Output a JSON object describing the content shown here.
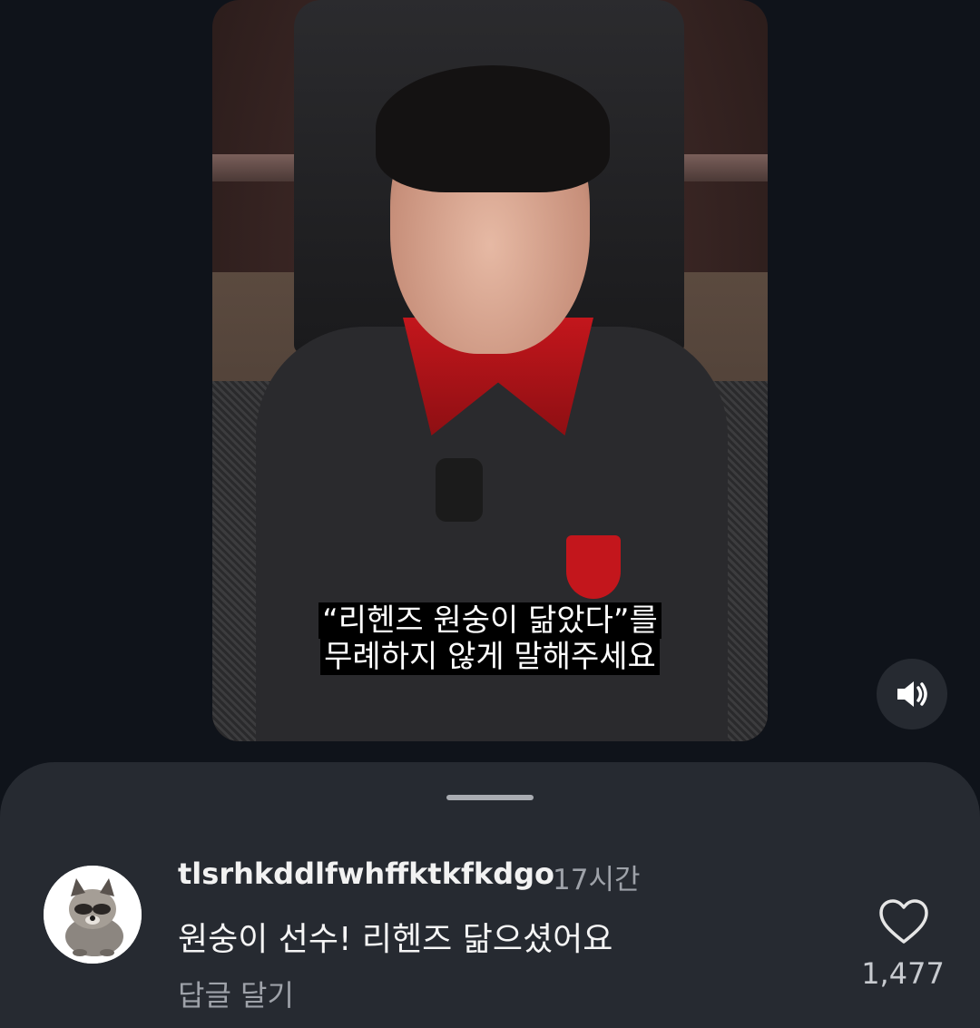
{
  "video": {
    "caption_line1": "“리헨즈 원숭이 닮았다”를",
    "caption_line2": "무례하지 않게 말해주세요"
  },
  "controls": {
    "mute_icon": "volume-icon"
  },
  "comment": {
    "username": "tlsrhkddlfwhffktkfkdgo",
    "time": "17시간",
    "text": "원숭이 선수! 리헨즈 닮으셨어요",
    "reply_label": "답글 달기",
    "like_count": "1,477",
    "like_icon": "heart-outline-icon",
    "avatar": "raccoon-avatar"
  },
  "colors": {
    "background": "#0f131a",
    "sheet": "#262a31",
    "secondary_text": "#9ea2a9"
  }
}
